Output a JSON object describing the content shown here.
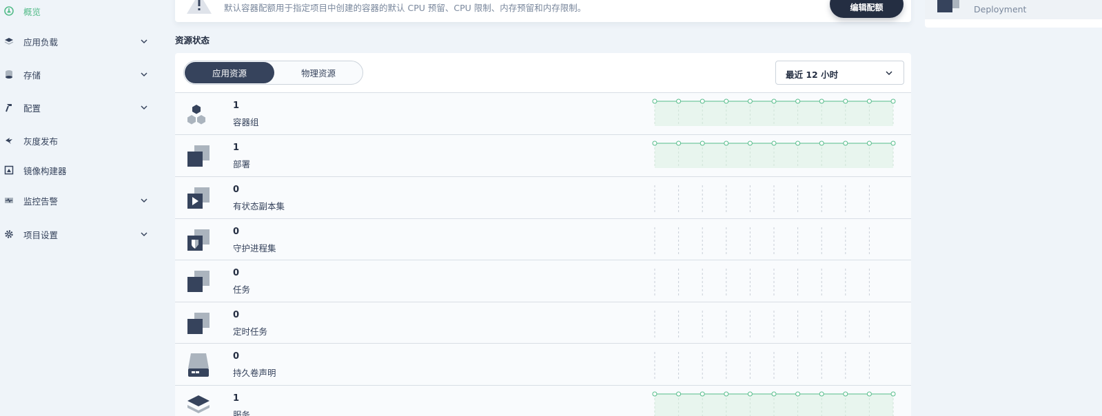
{
  "sidebar": {
    "items": [
      {
        "label": "概览",
        "icon": "dashboard-icon",
        "active": true,
        "expandable": false
      },
      {
        "label": "应用负载",
        "icon": "layers-icon",
        "active": false,
        "expandable": true
      },
      {
        "label": "存储",
        "icon": "database-icon",
        "active": false,
        "expandable": true
      },
      {
        "label": "配置",
        "icon": "hammer-icon",
        "active": false,
        "expandable": true
      },
      {
        "label": "灰度发布",
        "icon": "bird-icon",
        "active": false,
        "expandable": false
      },
      {
        "label": "镜像构建器",
        "icon": "image-builder-icon",
        "active": false,
        "expandable": false
      },
      {
        "label": "监控告警",
        "icon": "monitor-icon",
        "active": false,
        "expandable": true
      },
      {
        "label": "项目设置",
        "icon": "gear-icon",
        "active": false,
        "expandable": true
      }
    ]
  },
  "banner": {
    "description": "默认容器配额用于指定项目中创建的容器的默认 CPU 预留、CPU 限制、内存预留和内存限制。",
    "button_label": "编辑配额"
  },
  "right_panel": {
    "item_label": "Deployment"
  },
  "resource_status": {
    "title": "资源状态",
    "tabs": [
      {
        "label": "应用资源",
        "selected": true
      },
      {
        "label": "物理资源",
        "selected": false
      }
    ],
    "time_range": "最近 12 小时",
    "rows": [
      {
        "count": "1",
        "name": "容器组",
        "icon": "pods-icon",
        "series": [
          1,
          1,
          1,
          1,
          1,
          1,
          1,
          1,
          1,
          1,
          1
        ]
      },
      {
        "count": "1",
        "name": "部署",
        "icon": "deployment-icon",
        "series": [
          1,
          1,
          1,
          1,
          1,
          1,
          1,
          1,
          1,
          1,
          1
        ]
      },
      {
        "count": "0",
        "name": "有状态副本集",
        "icon": "statefulset-icon",
        "series": []
      },
      {
        "count": "0",
        "name": "守护进程集",
        "icon": "daemonset-icon",
        "series": []
      },
      {
        "count": "0",
        "name": "任务",
        "icon": "job-icon",
        "series": []
      },
      {
        "count": "0",
        "name": "定时任务",
        "icon": "cronjob-icon",
        "series": []
      },
      {
        "count": "0",
        "name": "持久卷声明",
        "icon": "volume-icon",
        "series": []
      },
      {
        "count": "1",
        "name": "服务",
        "icon": "service-icon",
        "series": [
          1,
          1,
          1,
          1,
          1,
          1,
          1,
          1,
          1,
          1,
          1
        ]
      }
    ]
  },
  "colors": {
    "accent": "#55bc8a",
    "dark": "#242e42",
    "icon": "#36435c"
  }
}
